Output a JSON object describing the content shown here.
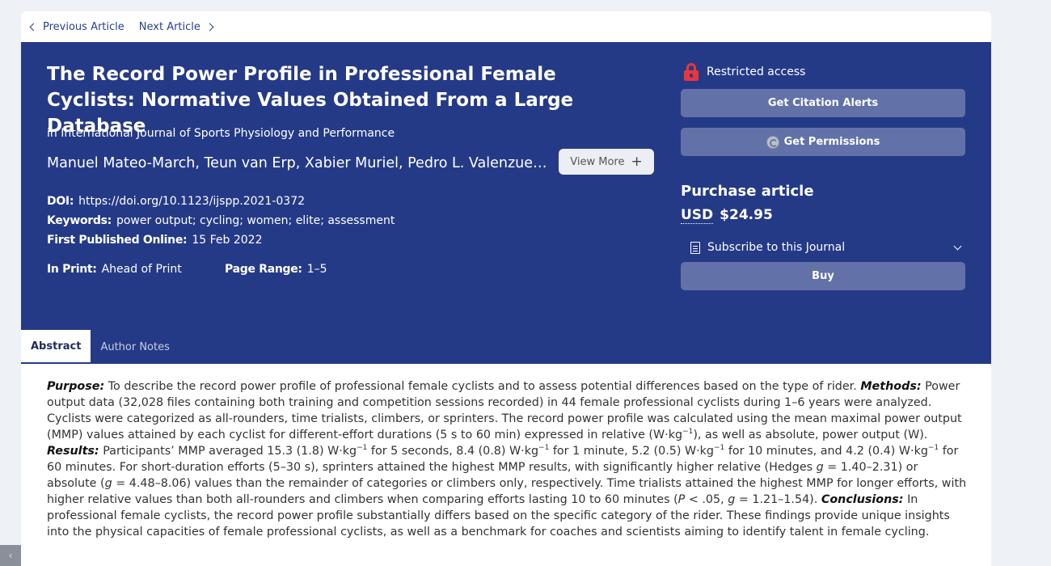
{
  "nav": {
    "previous_label": "Previous Article",
    "next_label": "Next Article"
  },
  "article": {
    "title": "The Record Power Profile in Professional Female Cyclists: Normative Values Obtained From a Large Database",
    "journal": "in International Journal of Sports Physiology and Performance",
    "authors": "Manuel Mateo-March, Teun van Erp, Xabier Muriel, Pedro L. Valenzuela, ...",
    "view_more_label": "View More",
    "doi_label": "DOI:",
    "doi_value": "https://doi.org/10.1123/ijspp.2021-0372",
    "keywords_label": "Keywords:",
    "keywords_value": "power output; cycling; women; elite; assessment",
    "published_label": "First Published Online:",
    "published_value": "15 Feb 2022",
    "print_label": "In Print:",
    "print_value": "Ahead of Print",
    "pages_label": "Page Range:",
    "pages_value": "1–5"
  },
  "sidebar": {
    "access_label": "Restricted access",
    "citation_alerts_label": "Get Citation Alerts",
    "permissions_label": "Get Permissions",
    "purchase_title": "Purchase article",
    "currency": "USD",
    "price": "$24.95",
    "subscribe_label": "Subscribe to this Journal",
    "buy_label": "Buy"
  },
  "tabs": [
    {
      "label": "Abstract",
      "active": true
    },
    {
      "label": "Author Notes",
      "active": false
    }
  ],
  "abstract": {
    "purpose_label": "Purpose:",
    "purpose_text": " To describe the record power profile of professional female cyclists and to assess potential differences based on the type of rider. ",
    "methods_label": "Methods:",
    "methods_text_1": " Power output data (32,028 files containing both training and competition sessions recorded) in 44 female professional cyclists during 1–6 years were analyzed. Cyclists were categorized as all-rounders, time trialists, climbers, or sprinters. The record power profile was calculated using the mean maximal power output (MMP) values attained by each cyclist for different-effort durations (5 s to 60 min) expressed in relative (W·kg",
    "methods_text_2": "), as well as absolute, power output (W). ",
    "results_label": "Results:",
    "results_text_1": " Participants’ MMP averaged 15.3 (1.8) W·kg",
    "results_text_2": " for 5 seconds, 8.4 (0.8) W·kg",
    "results_text_3": " for 1 minute, 5.2 (0.5) W·kg",
    "results_text_4": " for 10 minutes, and 4.2 (0.4) W·kg",
    "results_text_5": " for 60 minutes. For short-duration efforts (5–30 s), sprinters attained the highest MMP results, with significantly higher relative (Hedges ",
    "g_symbol": "g",
    "results_text_6": " = 1.40–2.31) or absolute (",
    "results_text_7": " = 4.48–8.06) values than the remainder of categories or climbers only, respectively. Time trialists attained the highest MMP for longer efforts, with higher relative values than both all-rounders and climbers when comparing efforts lasting 10 to 60 minutes (",
    "p_symbol": "P",
    "results_text_8": " < .05, ",
    "results_text_9": " = 1.21–1.54). ",
    "conclusions_label": "Conclusions:",
    "conclusions_text": " In professional female cyclists, the record power profile substantially differs based on the specific category of the rider. These findings provide unique insights into the physical capacities of female professional cyclists, as well as a benchmark for coaches and scientists aiming to identify talent in female cycling.",
    "sup_minus_one": "−1"
  },
  "side_handle": "‹",
  "colors": {
    "header_bg": "#253a86",
    "button_bg": "#6272a8",
    "lock_red": "#e8373c"
  }
}
